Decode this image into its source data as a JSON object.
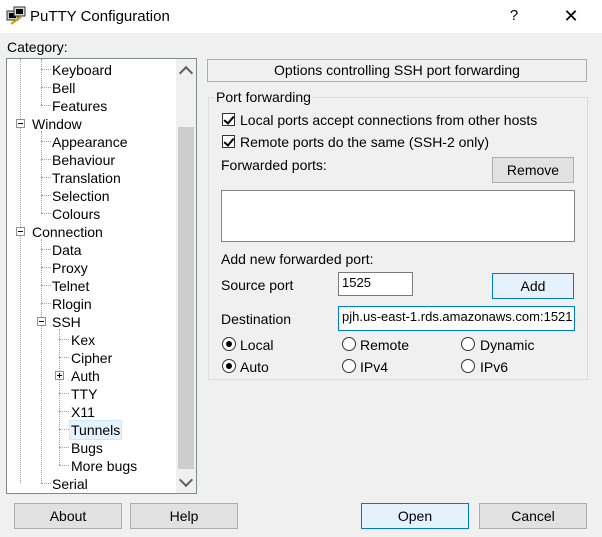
{
  "window": {
    "title": "PuTTY Configuration",
    "help": "?",
    "close": "✕"
  },
  "category_label": "Category:",
  "tree": [
    {
      "label": "Keyboard"
    },
    {
      "label": "Bell"
    },
    {
      "label": "Features"
    },
    {
      "label": "Window"
    },
    {
      "label": "Appearance"
    },
    {
      "label": "Behaviour"
    },
    {
      "label": "Translation"
    },
    {
      "label": "Selection"
    },
    {
      "label": "Colours"
    },
    {
      "label": "Connection"
    },
    {
      "label": "Data"
    },
    {
      "label": "Proxy"
    },
    {
      "label": "Telnet"
    },
    {
      "label": "Rlogin"
    },
    {
      "label": "SSH"
    },
    {
      "label": "Kex"
    },
    {
      "label": "Cipher"
    },
    {
      "label": "Auth"
    },
    {
      "label": "TTY"
    },
    {
      "label": "X11"
    },
    {
      "label": "Tunnels",
      "selected": true
    },
    {
      "label": "Bugs"
    },
    {
      "label": "More bugs"
    },
    {
      "label": "Serial"
    }
  ],
  "panel": {
    "header": "Options controlling SSH port forwarding",
    "group_title": "Port forwarding",
    "local_accept": {
      "label": "Local ports accept connections from other hosts",
      "checked": true
    },
    "remote_same": {
      "label": "Remote ports do the same (SSH-2 only)",
      "checked": true
    },
    "forwarded_ports_label": "Forwarded ports:",
    "remove_label": "Remove",
    "add_new_label": "Add new forwarded port:",
    "source_port_label": "Source port",
    "source_port_value": "1525",
    "add_label": "Add",
    "destination_label": "Destination",
    "destination_value": "pjh.us-east-1.rds.amazonaws.com:1521",
    "direction": {
      "local": "Local",
      "remote": "Remote",
      "dynamic": "Dynamic",
      "selected": "Local"
    },
    "ipver": {
      "auto": "Auto",
      "ipv4": "IPv4",
      "ipv6": "IPv6",
      "selected": "Auto"
    }
  },
  "buttons": {
    "about": "About",
    "help": "Help",
    "open": "Open",
    "cancel": "Cancel"
  }
}
